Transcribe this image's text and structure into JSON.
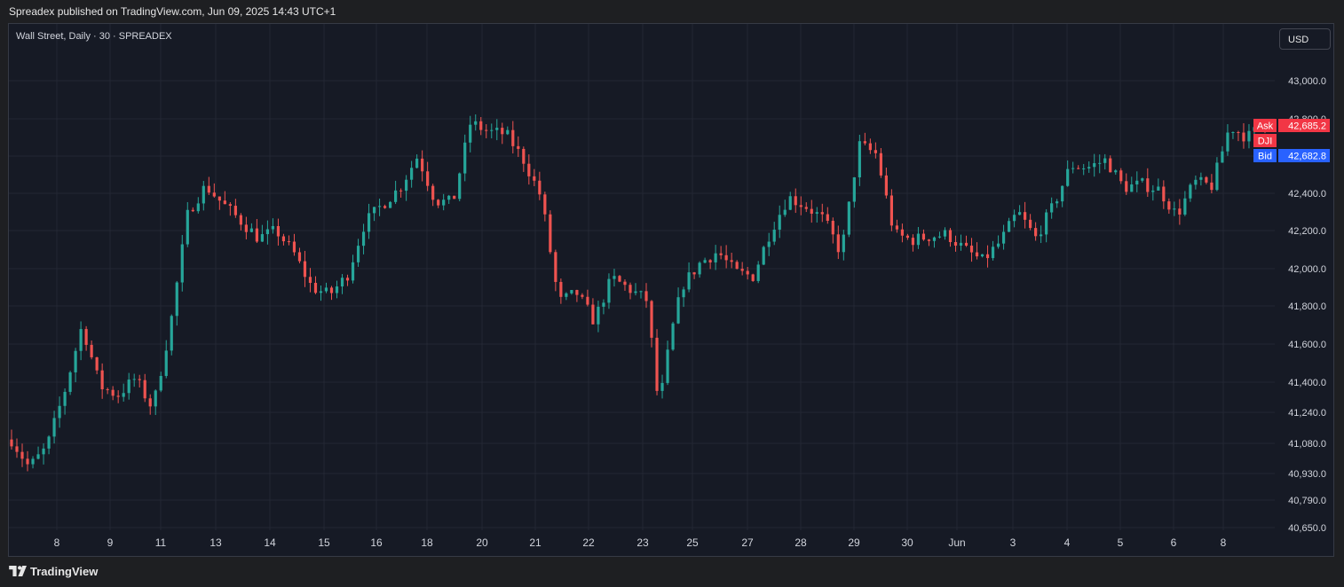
{
  "header": {
    "published_by": "Spreadex published on TradingView.com, Jun 09, 2025 14:43 UTC+1"
  },
  "symbol_line": "Wall Street, Daily · 30 · SPREADEX",
  "currency_button": "USD",
  "footer": {
    "brand": "TradingView",
    "logo_icon": "tradingview-logo-icon"
  },
  "colors": {
    "background": "#161a25",
    "grid": "#232734",
    "up": "#26a69a",
    "down": "#ef5350",
    "ask": "#f23645",
    "bid": "#2962ff",
    "symbol_tag": "#f23645"
  },
  "price_labels": {
    "ask_label": "Ask",
    "ask_value": "42,685.2",
    "symbol_label": "DJI",
    "bid_label": "Bid",
    "bid_value": "42,682.8"
  },
  "chart_data": {
    "type": "candlestick",
    "title": "Wall Street, Daily · 30 · SPREADEX",
    "y_ticks": [
      "43,000.0",
      "42,800.0",
      "42,600.0",
      "42,400.0",
      "42,200.0",
      "42,000.0",
      "41,800.0",
      "41,600.0",
      "41,400.0",
      "41,240.0",
      "41,080.0",
      "40,930.0",
      "40,790.0",
      "40,650.0"
    ],
    "y_tick_values": [
      43000,
      42800,
      42600,
      42400,
      42200,
      42000,
      41800,
      41600,
      41400,
      41240,
      41080,
      40930,
      40790,
      40650
    ],
    "x_ticks": [
      "8",
      "9",
      "11",
      "13",
      "14",
      "15",
      "16",
      "18",
      "20",
      "21",
      "22",
      "23",
      "25",
      "27",
      "28",
      "29",
      "30",
      "Jun",
      "3",
      "4",
      "5",
      "6",
      "8"
    ],
    "ylim": [
      40650,
      43000
    ],
    "grid": true,
    "price_path": [
      {
        "t": 0,
        "p": 41100
      },
      {
        "t": 3,
        "p": 40960
      },
      {
        "t": 6,
        "p": 41060
      },
      {
        "t": 9,
        "p": 41350
      },
      {
        "t": 12,
        "p": 41700
      },
      {
        "t": 15,
        "p": 41380
      },
      {
        "t": 18,
        "p": 41330
      },
      {
        "t": 21,
        "p": 41420
      },
      {
        "t": 24,
        "p": 41260
      },
      {
        "t": 27,
        "p": 41700
      },
      {
        "t": 30,
        "p": 42300
      },
      {
        "t": 33,
        "p": 42440
      },
      {
        "t": 36,
        "p": 42340
      },
      {
        "t": 39,
        "p": 42250
      },
      {
        "t": 42,
        "p": 42160
      },
      {
        "t": 45,
        "p": 42200
      },
      {
        "t": 48,
        "p": 42080
      },
      {
        "t": 51,
        "p": 41900
      },
      {
        "t": 54,
        "p": 41860
      },
      {
        "t": 57,
        "p": 41960
      },
      {
        "t": 60,
        "p": 42240
      },
      {
        "t": 63,
        "p": 42340
      },
      {
        "t": 66,
        "p": 42430
      },
      {
        "t": 69,
        "p": 42600
      },
      {
        "t": 72,
        "p": 42360
      },
      {
        "t": 75,
        "p": 42350
      },
      {
        "t": 78,
        "p": 42780
      },
      {
        "t": 81,
        "p": 42730
      },
      {
        "t": 84,
        "p": 42720
      },
      {
        "t": 87,
        "p": 42580
      },
      {
        "t": 90,
        "p": 42380
      },
      {
        "t": 93,
        "p": 41820
      },
      {
        "t": 96,
        "p": 41870
      },
      {
        "t": 99,
        "p": 41720
      },
      {
        "t": 102,
        "p": 41950
      },
      {
        "t": 105,
        "p": 41890
      },
      {
        "t": 108,
        "p": 41830
      },
      {
        "t": 110,
        "p": 41260
      },
      {
        "t": 112,
        "p": 41640
      },
      {
        "t": 114,
        "p": 41910
      },
      {
        "t": 117,
        "p": 42030
      },
      {
        "t": 120,
        "p": 42090
      },
      {
        "t": 123,
        "p": 41980
      },
      {
        "t": 126,
        "p": 41960
      },
      {
        "t": 129,
        "p": 42200
      },
      {
        "t": 132,
        "p": 42380
      },
      {
        "t": 135,
        "p": 42330
      },
      {
        "t": 138,
        "p": 42260
      },
      {
        "t": 141,
        "p": 42080
      },
      {
        "t": 144,
        "p": 42660
      },
      {
        "t": 147,
        "p": 42610
      },
      {
        "t": 150,
        "p": 42180
      },
      {
        "t": 153,
        "p": 42150
      },
      {
        "t": 156,
        "p": 42170
      },
      {
        "t": 159,
        "p": 42180
      },
      {
        "t": 162,
        "p": 42100
      },
      {
        "t": 165,
        "p": 42040
      },
      {
        "t": 168,
        "p": 42140
      },
      {
        "t": 171,
        "p": 42300
      },
      {
        "t": 174,
        "p": 42160
      },
      {
        "t": 177,
        "p": 42330
      },
      {
        "t": 180,
        "p": 42550
      },
      {
        "t": 183,
        "p": 42540
      },
      {
        "t": 186,
        "p": 42580
      },
      {
        "t": 189,
        "p": 42430
      },
      {
        "t": 192,
        "p": 42450
      },
      {
        "t": 195,
        "p": 42420
      },
      {
        "t": 198,
        "p": 42280
      },
      {
        "t": 201,
        "p": 42460
      },
      {
        "t": 204,
        "p": 42440
      },
      {
        "t": 207,
        "p": 42760
      },
      {
        "t": 210,
        "p": 42700
      },
      {
        "t": 213,
        "p": 42780
      }
    ]
  }
}
